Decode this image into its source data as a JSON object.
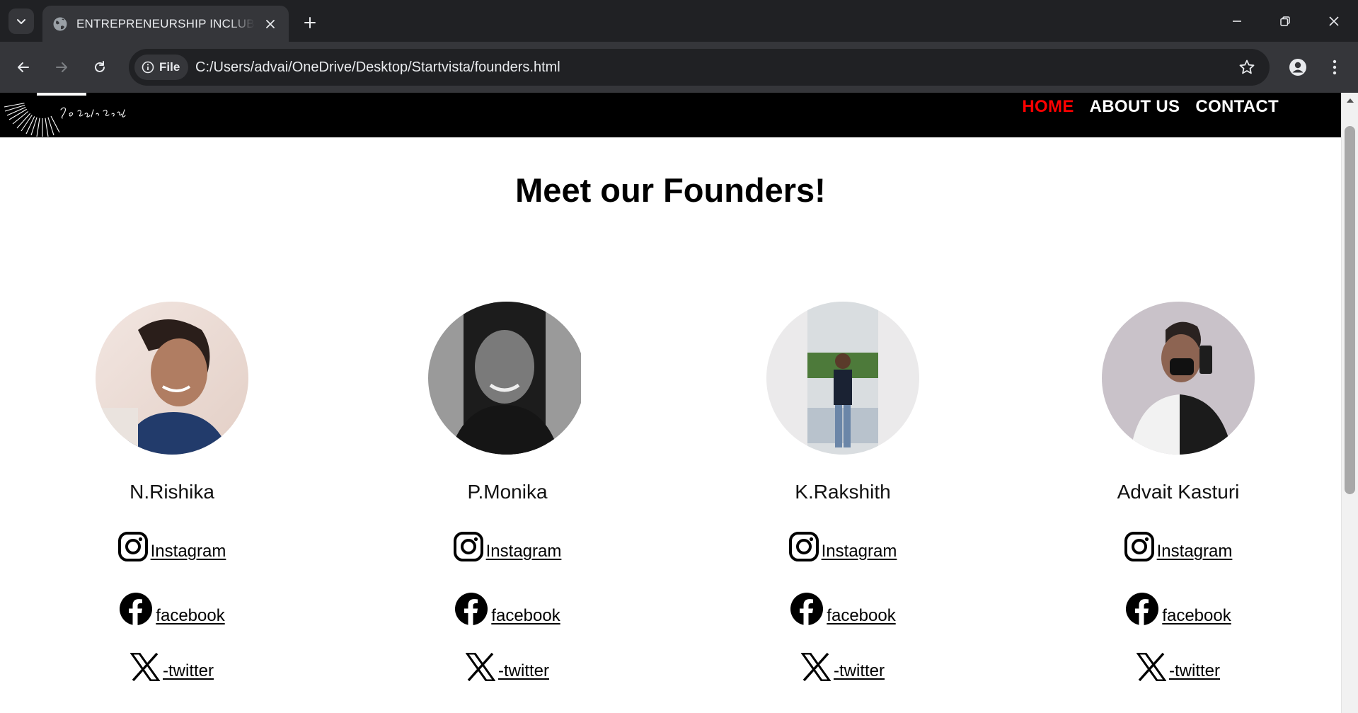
{
  "browser": {
    "tab": {
      "title": "ENTREPRENEURSHIP INCLUBLA"
    },
    "omnibox": {
      "chip_label": "File",
      "url": "C:/Users/advai/OneDrive/Desktop/Startvista/founders.html"
    }
  },
  "site": {
    "logo": {
      "tagline": "Dream Build Succeed"
    },
    "nav": [
      {
        "label": "HOME",
        "active": true
      },
      {
        "label": "ABOUT US",
        "active": false
      },
      {
        "label": "CONTACT",
        "active": false
      }
    ],
    "title": "Meet our Founders!",
    "founders": [
      {
        "name": "N.Rishika",
        "instagram": "Instagram",
        "facebook": "facebook",
        "twitter": "-twitter"
      },
      {
        "name": "P.Monika",
        "instagram": "Instagram",
        "facebook": "facebook",
        "twitter": "-twitter"
      },
      {
        "name": "K.Rakshith",
        "instagram": "Instagram",
        "facebook": "facebook",
        "twitter": "-twitter"
      },
      {
        "name": "Advait Kasturi",
        "instagram": "Instagram",
        "facebook": "facebook",
        "twitter": "-twitter"
      }
    ]
  },
  "colors": {
    "nav_active": "#ff0000",
    "header_bg": "#000000",
    "chrome_dark": "#202124",
    "chrome_toolbar": "#35363a"
  }
}
